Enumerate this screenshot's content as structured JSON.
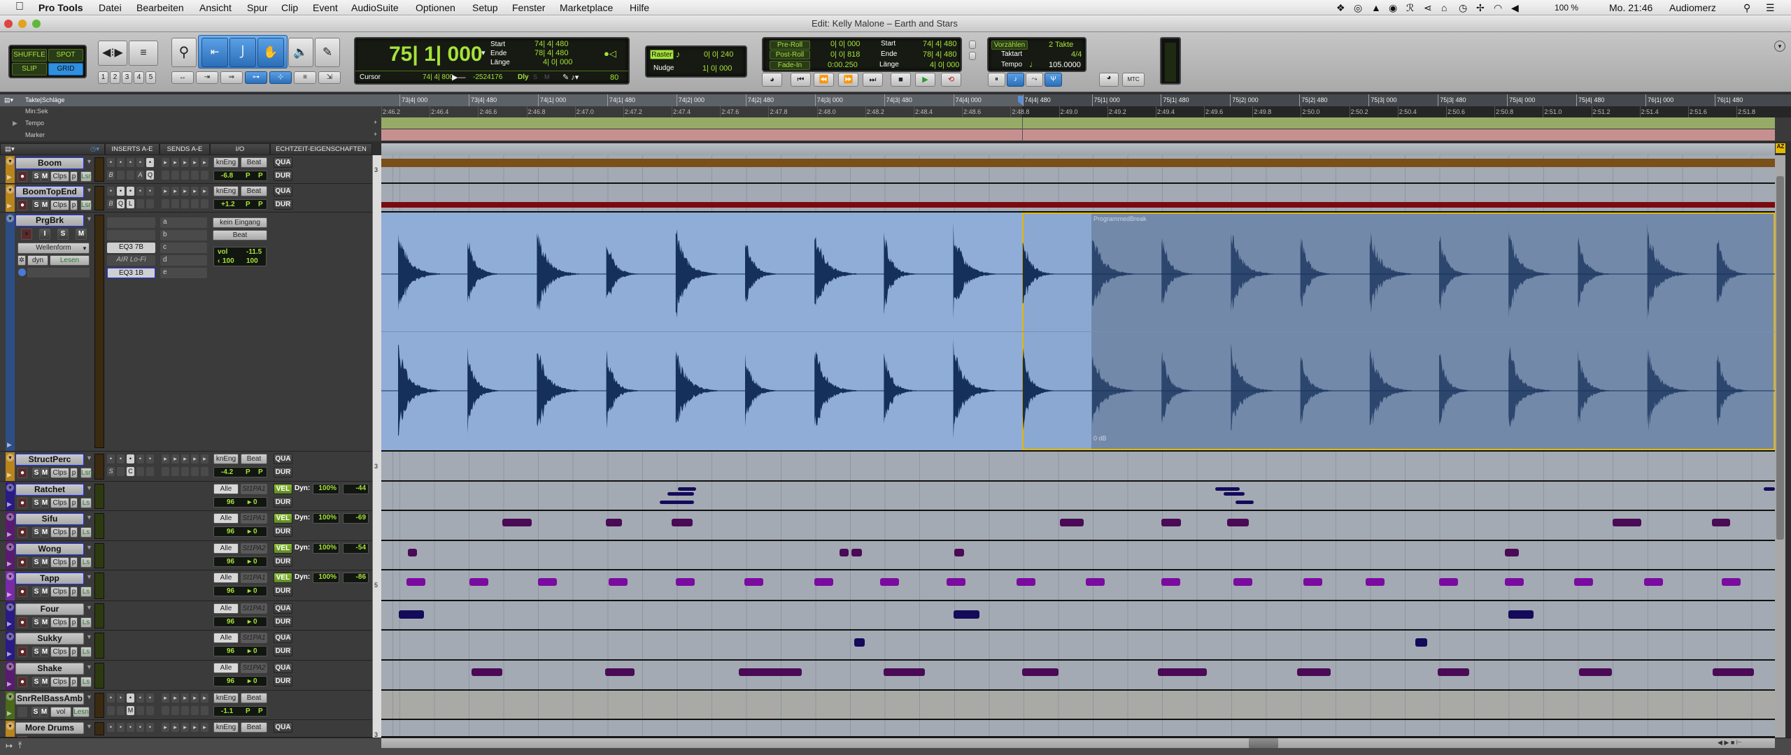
{
  "menubar": {
    "app": "Pro Tools",
    "items": [
      "Datei",
      "Bearbeiten",
      "Ansicht",
      "Spur",
      "Clip",
      "Event",
      "AudioSuite",
      "Optionen",
      "Setup",
      "Fenster",
      "Marketplace",
      "Hilfe"
    ],
    "status_icons": [
      "dropbox-icon",
      "creative-cloud-icon",
      "google-drive-icon",
      "sync-icon",
      "evernote-icon",
      "share-icon",
      "home-icon",
      "time-machine-icon",
      "bluetooth-icon",
      "wifi-icon",
      "volume-icon"
    ],
    "battery": "100 %",
    "clock": "Mo. 21:46",
    "user": "Audiomerz"
  },
  "window": {
    "title": "Edit: Kelly Malone – Earth and Stars"
  },
  "toolbar": {
    "modes": {
      "shuffle": "SHUFFLE",
      "spot": "SPOT",
      "slip": "SLIP",
      "grid": "GRID",
      "active": "GRID"
    },
    "zoom_presets": [
      "1",
      "2",
      "3",
      "4",
      "5"
    ],
    "counter": {
      "main": "75| 1| 000",
      "start_label": "Start",
      "start": "74| 4| 480",
      "end_label": "Ende",
      "end": "78| 4| 480",
      "length_label": "Länge",
      "length": "4| 0| 000",
      "cursor_label": "Cursor",
      "cursor": "74| 4| 800",
      "sample": "-2524176",
      "dly": "Dly",
      "s": "S",
      "m": "M",
      "value": "80"
    },
    "grid": {
      "raster_label": "Raster",
      "raster": "0| 0| 240",
      "nudge_label": "Nudge",
      "nudge": "1| 0| 000"
    },
    "transport": {
      "preroll_label": "Pre-Roll",
      "preroll": "0| 0| 000",
      "postroll_label": "Post-Roll",
      "postroll": "0| 0| 818",
      "fadein_label": "Fade-In",
      "fadein": "0:00.250",
      "start_label": "Start",
      "start": "74| 4| 480",
      "end_label": "Ende",
      "end": "78| 4| 480",
      "length_label": "Länge",
      "length": "4| 0| 000"
    },
    "midi": {
      "countoff_label": "Vorzählen",
      "countoff": "2 Takte",
      "meter_label": "Taktart",
      "meter": "4/4",
      "tempo_label": "Tempo",
      "tempo": "105.0000"
    },
    "mtc": "MTC"
  },
  "rulers": {
    "bars_label": "Takte|Schläge",
    "minsec_label": "Min:Sek",
    "tempo_label": "Tempo",
    "marker_label": "Marker",
    "bars": [
      "73|4| 000",
      "73|4| 480",
      "74|1| 000",
      "74|1| 480",
      "74|2| 000",
      "74|2| 480",
      "74|3| 000",
      "74|3| 480",
      "74|4| 000",
      "74|4| 480",
      "75|1| 000",
      "75|1| 480",
      "75|2| 000",
      "75|2| 480",
      "75|3| 000",
      "75|3| 480",
      "75|4| 000",
      "75|4| 480",
      "76|1| 000",
      "76|1| 480"
    ],
    "minsec": [
      "2:46.2",
      "2:46.4",
      "2:46.6",
      "2:46.8",
      "2:47.0",
      "2:47.2",
      "2:47.4",
      "2:47.6",
      "2:47.8",
      "2:48.0",
      "2:48.2",
      "2:48.4",
      "2:48.6",
      "2:48.8",
      "2:49.0",
      "2:49.2",
      "2:49.4",
      "2:49.6",
      "2:49.8",
      "2:50.0",
      "2:50.2",
      "2:50.4",
      "2:50.6",
      "2:50.8",
      "2:51.0",
      "2:51.2",
      "2:51.4",
      "2:51.6",
      "2:51.8"
    ]
  },
  "columns": {
    "inserts": "INSERTS A-E",
    "sends": "SENDS A-E",
    "io": "I/O",
    "rtp": "ECHTZEIT-EIGENSCHAFTEN"
  },
  "clip": {
    "name": "ProgrammedBreak",
    "gain": "0 dB"
  },
  "colors": {
    "tempo_ruler": "#97ab66",
    "marker_ruler": "#c79090",
    "selection": "#8fadd6",
    "clip": "#7389aa",
    "clip_outline": "#e6b800",
    "boom_clip": "#7a5018",
    "boomtopend_clip": "#7a0a10",
    "waveform": "#15305a"
  },
  "tracks": [
    {
      "name": "Boom",
      "kind": "audio",
      "color": "#b8841c",
      "sel": true,
      "buttons": [
        "S",
        "M",
        "Clps",
        "p",
        "Lsn"
      ],
      "ins_on": [
        4
      ],
      "ins": [
        "B",
        "",
        "",
        "A",
        "Q"
      ],
      "io": [
        "knEng",
        "Beat"
      ],
      "vol": "-6.8",
      "pan": [
        "P",
        "P"
      ],
      "rtp": [
        "QUA",
        "DUR"
      ],
      "scale": "3"
    },
    {
      "name": "BoomTopEnd",
      "kind": "audio",
      "color": "#b8841c",
      "sel": true,
      "buttons": [
        "S",
        "M",
        "Clps",
        "p",
        "Lsn"
      ],
      "ins_on": [
        1,
        2
      ],
      "ins": [
        "B",
        "Q",
        "L",
        "",
        ""
      ],
      "io": [
        "knEng",
        "Beat"
      ],
      "vol": "+1.2",
      "pan": [
        "P",
        "P"
      ],
      "rtp": [
        "QUA",
        "DUR"
      ]
    },
    {
      "name": "PrgBrk",
      "kind": "big",
      "color": "#2d4d85",
      "sel": true,
      "buttons": [
        "I",
        "S",
        "M"
      ],
      "view": "Wellenform",
      "dyn": "dyn",
      "auto": "Lesen",
      "inserts": [
        "",
        "",
        "EQ3 7B",
        "AIR Lo-Fi",
        "EQ3 1B"
      ],
      "sends": [
        "a",
        "b",
        "c",
        "d",
        "e"
      ],
      "input": "kein Eingang",
      "output": "Beat",
      "vol_label": "vol",
      "vol": "-11.5",
      "pan": [
        "100",
        "100"
      ]
    },
    {
      "name": "StructPerc",
      "kind": "audio",
      "color": "#b8841c",
      "sel": true,
      "buttons": [
        "S",
        "M",
        "Clps",
        "p",
        "Lsn"
      ],
      "ins_on": [
        2
      ],
      "ins": [
        "S",
        "",
        "C",
        "",
        ""
      ],
      "io": [
        "knEng",
        "Beat"
      ],
      "vol": "-4.2",
      "pan": [
        "P",
        "P"
      ],
      "rtp": [
        "QUA",
        "DUR"
      ],
      "scale": "3"
    },
    {
      "name": "Ratchet",
      "kind": "midi",
      "color": "#2a1a85",
      "sel": true,
      "buttons": [
        "S",
        "M",
        "Clps",
        "p",
        "Ls"
      ],
      "io": [
        "Alle",
        "St1PA1"
      ],
      "velocity": "96",
      "offset": "0",
      "rtp": [
        "VEL",
        "DUR"
      ],
      "dyn_label": "Dyn:",
      "dyn": "100%",
      "dyn_offset": "-44",
      "note_color": "#140a5a"
    },
    {
      "name": "Sifu",
      "kind": "midi",
      "color": "#5a1a72",
      "sel": true,
      "buttons": [
        "S",
        "M",
        "Clps",
        "p",
        "Ls"
      ],
      "io": [
        "Alle",
        "St1PA1"
      ],
      "velocity": "96",
      "offset": "0",
      "rtp": [
        "VEL",
        "DUR"
      ],
      "dyn_label": "Dyn:",
      "dyn": "100%",
      "dyn_offset": "-69",
      "note_color": "#4a0a55"
    },
    {
      "name": "Wong",
      "kind": "midi",
      "color": "#5a1a72",
      "sel": true,
      "buttons": [
        "S",
        "M",
        "Clps",
        "p",
        "Ls"
      ],
      "io": [
        "Alle",
        "St1PA2"
      ],
      "velocity": "96",
      "offset": "0",
      "rtp": [
        "VEL",
        "DUR"
      ],
      "dyn_label": "Dyn:",
      "dyn": "100%",
      "dyn_offset": "-54",
      "note_color": "#4a0a55"
    },
    {
      "name": "Tapp",
      "kind": "midi",
      "color": "#7a2aa8",
      "sel": true,
      "buttons": [
        "S",
        "M",
        "Clps",
        "p",
        "Ls"
      ],
      "io": [
        "Alle",
        "St1PA1"
      ],
      "velocity": "96",
      "offset": "0",
      "rtp": [
        "VEL",
        "DUR"
      ],
      "dyn_label": "Dyn:",
      "dyn": "100%",
      "dyn_offset": "-86",
      "note_color": "#7a0aa0",
      "scale": "5"
    },
    {
      "name": "Four",
      "kind": "midi",
      "color": "#2a1a85",
      "sel": false,
      "buttons": [
        "S",
        "M",
        "Clps",
        "p",
        "Ls"
      ],
      "io": [
        "Alle",
        "St1PA1"
      ],
      "velocity": "96",
      "offset": "0",
      "rtp": [
        "QUA",
        "DUR"
      ],
      "note_color": "#140a5a"
    },
    {
      "name": "Sukky",
      "kind": "midi",
      "color": "#2a1a85",
      "sel": false,
      "buttons": [
        "S",
        "M",
        "Clps",
        "p",
        "Ls"
      ],
      "io": [
        "Alle",
        "St1PA1"
      ],
      "velocity": "96",
      "offset": "0",
      "rtp": [
        "QUA",
        "DUR"
      ],
      "note_color": "#140a5a"
    },
    {
      "name": "Shake",
      "kind": "midi",
      "color": "#5a1a72",
      "sel": false,
      "buttons": [
        "S",
        "M",
        "Clps",
        "p",
        "Ls"
      ],
      "io": [
        "Alle",
        "St1PA2"
      ],
      "velocity": "96",
      "offset": "0",
      "rtp": [
        "QUA",
        "DUR"
      ],
      "note_color": "#4a0a55"
    },
    {
      "name": "SnrRelBassAmb",
      "kind": "audio",
      "color": "#4a6a1a",
      "sel": false,
      "norec": true,
      "buttons": [
        "S",
        "M",
        "vol",
        "Lesn"
      ],
      "ins_on": [
        2
      ],
      "ins": [
        "",
        "",
        "M",
        "",
        ""
      ],
      "io": [
        "knEng",
        "Beat"
      ],
      "vol": "-1.1",
      "pan": [
        "P",
        "P"
      ],
      "rtp": []
    },
    {
      "name": "More Drums",
      "kind": "audio",
      "color": "#b8841c",
      "sel": false,
      "buttons": [],
      "ins_on": [],
      "ins": [],
      "io": [
        "knEng",
        "Beat"
      ],
      "vol": "",
      "pan": [],
      "rtp": [
        "QUA"
      ],
      "scale": "3"
    }
  ]
}
